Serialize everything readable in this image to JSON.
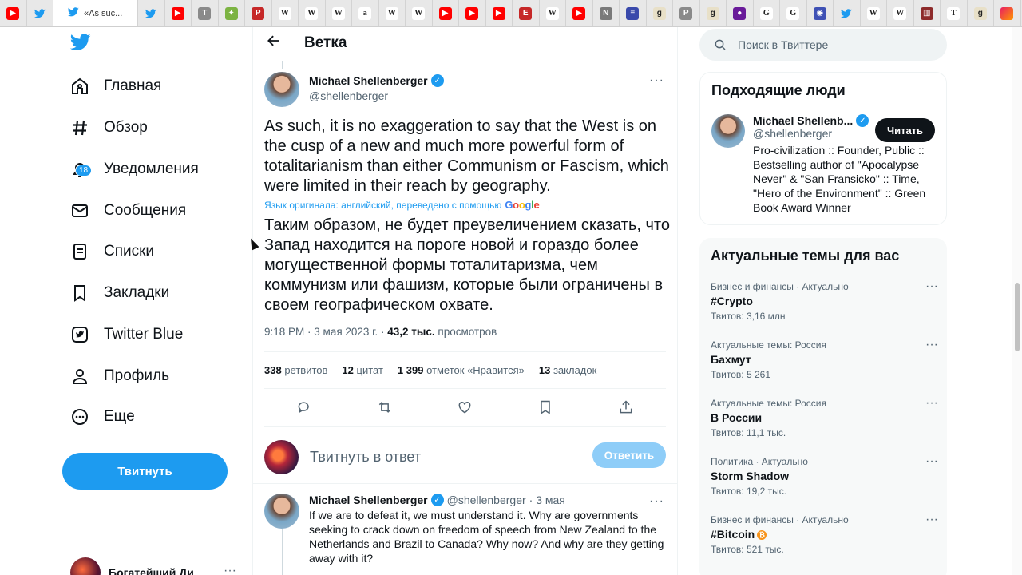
{
  "browser": {
    "active_tab_title": "«As suc...",
    "tabs": [
      {
        "icon": "youtube-icon",
        "glyph": "▶",
        "bg": "#ff0000"
      },
      {
        "icon": "twitter-icon",
        "glyph": "",
        "bg": "#ffffff"
      },
      {
        "icon": "twitter-icon",
        "glyph": "",
        "bg": "#ffffff"
      },
      {
        "icon": "youtube-icon",
        "glyph": "▶",
        "bg": "#ff0000"
      },
      {
        "icon": "t-icon",
        "glyph": "T",
        "bg": "#8a8a8a"
      },
      {
        "icon": "green-icon",
        "glyph": "✦",
        "bg": "#7cb342"
      },
      {
        "icon": "p-icon",
        "glyph": "P",
        "bg": "#c62828"
      },
      {
        "icon": "wikipedia-icon",
        "glyph": "W",
        "bg": "#ffffff"
      },
      {
        "icon": "wikipedia-icon",
        "glyph": "W",
        "bg": "#ffffff"
      },
      {
        "icon": "wikipedia-icon",
        "glyph": "W",
        "bg": "#ffffff"
      },
      {
        "icon": "amazon-icon",
        "glyph": "a",
        "bg": "#ffffff"
      },
      {
        "icon": "wikipedia-icon",
        "glyph": "W",
        "bg": "#ffffff"
      },
      {
        "icon": "wikipedia-icon",
        "glyph": "W",
        "bg": "#ffffff"
      },
      {
        "icon": "youtube-icon",
        "glyph": "▶",
        "bg": "#ff0000"
      },
      {
        "icon": "youtube-icon",
        "glyph": "▶",
        "bg": "#ff0000"
      },
      {
        "icon": "youtube-icon",
        "glyph": "▶",
        "bg": "#ff0000"
      },
      {
        "icon": "e-icon",
        "glyph": "E",
        "bg": "#c62828"
      },
      {
        "icon": "wikipedia-icon",
        "glyph": "W",
        "bg": "#ffffff"
      },
      {
        "icon": "youtube-icon",
        "glyph": "▶",
        "bg": "#ff0000"
      },
      {
        "icon": "n-icon",
        "glyph": "N",
        "bg": "#7a7a7a"
      },
      {
        "icon": "flag-icon",
        "glyph": "≡",
        "bg": "#3949ab"
      },
      {
        "icon": "goodreads-icon",
        "glyph": "g",
        "bg": "#e8e0c8"
      },
      {
        "icon": "p-icon",
        "glyph": "P",
        "bg": "#8a8a8a"
      },
      {
        "icon": "goodreads-icon",
        "glyph": "g",
        "bg": "#e8e0c8"
      },
      {
        "icon": "purple-icon",
        "glyph": "●",
        "bg": "#6a1b9a"
      },
      {
        "icon": "google-icon",
        "glyph": "G",
        "bg": "#ffffff"
      },
      {
        "icon": "google-icon",
        "glyph": "G",
        "bg": "#ffffff"
      },
      {
        "icon": "globe-icon",
        "glyph": "◉",
        "bg": "#3f51b5"
      },
      {
        "icon": "twitter-icon",
        "glyph": "",
        "bg": "#ffffff"
      },
      {
        "icon": "wikipedia-icon",
        "glyph": "W",
        "bg": "#ffffff"
      },
      {
        "icon": "wikipedia-icon",
        "glyph": "W",
        "bg": "#ffffff"
      },
      {
        "icon": "book-icon",
        "glyph": "▥",
        "bg": "#8d2a2a"
      },
      {
        "icon": "nyt-icon",
        "glyph": "T",
        "bg": "#ffffff"
      },
      {
        "icon": "goodreads-icon",
        "glyph": "g",
        "bg": "#e8e0c8"
      },
      {
        "icon": "gradient-icon",
        "glyph": "",
        "bg": "#e91e63"
      }
    ]
  },
  "nav": {
    "items": [
      {
        "label": "Главная",
        "icon": "home-icon"
      },
      {
        "label": "Обзор",
        "icon": "hashtag-icon"
      },
      {
        "label": "Уведомления",
        "icon": "bell-icon"
      },
      {
        "label": "Сообщения",
        "icon": "envelope-icon"
      },
      {
        "label": "Списки",
        "icon": "list-icon"
      },
      {
        "label": "Закладки",
        "icon": "bookmark-icon"
      },
      {
        "label": "Twitter Blue",
        "icon": "twitter-blue-icon"
      },
      {
        "label": "Профиль",
        "icon": "person-icon"
      },
      {
        "label": "Еще",
        "icon": "more-circle-icon"
      }
    ],
    "notifications_count": "18",
    "tweet_button": "Твитнуть",
    "account_name": "Богатейший Ди",
    "account_more": "···"
  },
  "thread": {
    "header_title": "Ветка",
    "author_name": "Michael Shellenberger",
    "author_handle": "@shellenberger",
    "more": "···",
    "original_text": "As such, it is no exaggeration to say that the West is on the cusp of a new and much more powerful form of totalitarianism than either Communism or Fascism, which were limited in their reach by geography.",
    "translation_note": "Язык оригинала: английский, переведено с помощью",
    "translation_provider": "Google",
    "translated_text": "Таким образом, не будет преувеличением сказать, что Запад находится на пороге новой и гораздо более могущественной формы тоталитаризма, чем коммунизм или фашизм, которые были ограничены в своем географическом охвате.",
    "timestamp": "9:18 PM · 3 мая 2023 г. · ",
    "views_count": "43,2 тыс.",
    "views_label": " просмотров",
    "stats": [
      {
        "count": "338",
        "label": " ретвитов"
      },
      {
        "count": "12",
        "label": " цитат"
      },
      {
        "count": "1 399",
        "label": " отметок «Нравится»"
      },
      {
        "count": "13",
        "label": " закладок"
      }
    ],
    "reply_placeholder": "Твитнуть в ответ",
    "reply_button": "Ответить",
    "next_tweet": {
      "author_name": "Michael Shellenberger",
      "author_handle": "@shellenberger",
      "date": "· 3 мая",
      "text": "If we are to defeat it, we must understand it. Why are governments seeking to crack down on freedom of speech from New Zealand to the Netherlands and Brazil to Canada? Why now? And why are they getting away with it?"
    }
  },
  "sidebar": {
    "search_placeholder": "Поиск в Твиттере",
    "who_to_follow_title": "Подходящие люди",
    "suggestion": {
      "name": "Michael Shellenb...",
      "handle": "@shellenberger",
      "bio": "Pro-civilization :: Founder, Public :: Bestselling author of \"Apocalypse Never\" & \"San Fransicko\" :: Time, \"Hero of the Environment\" :: Green Book Award Winner",
      "follow_button": "Читать"
    },
    "trends_title": "Актуальные темы для вас",
    "trends": [
      {
        "category": "Бизнес и финансы · Актуально",
        "name": "#Crypto",
        "count": "Твитов: 3,16 млн"
      },
      {
        "category": "Актуальные темы: Россия",
        "name": "Бахмут",
        "count": "Твитов: 5 261"
      },
      {
        "category": "Актуальные темы: Россия",
        "name": "В России",
        "count": "Твитов: 11,1 тыс."
      },
      {
        "category": "Политика · Актуально",
        "name": "Storm Shadow",
        "count": "Твитов: 19,2 тыс."
      },
      {
        "category": "Бизнес и финансы · Актуально",
        "name": "#Bitcoin",
        "count": "Твитов: 521 тыс."
      }
    ],
    "bitcoin_glyph": "₿"
  },
  "colors": {
    "accent": "#1d9bf0",
    "text": "#0f1419",
    "secondary": "#536471"
  }
}
